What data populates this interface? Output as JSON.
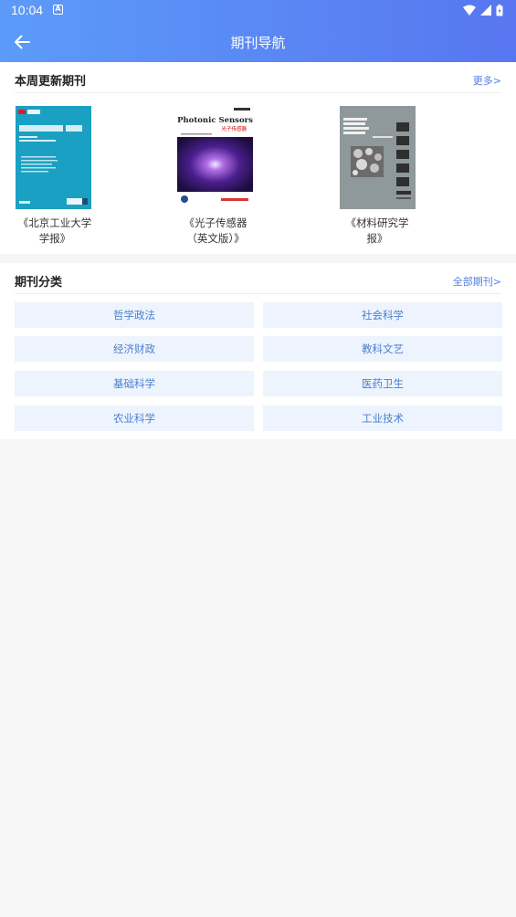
{
  "status_bar": {
    "time": "10:04",
    "a_icon_label": "A"
  },
  "nav": {
    "title": "期刊导航"
  },
  "weekly": {
    "title": "本周更新期刊",
    "more": "更多>",
    "journals": [
      {
        "name_line1": "《北京工业大学",
        "name_line2": "学报》",
        "cover_title": "北京工业大学 学报"
      },
      {
        "name_line1": "《光子传感器",
        "name_line2": "（英文版）》",
        "cover_title": "Photonic Sensors",
        "cover_subtitle": "光子传感器"
      },
      {
        "name_line1": "《材料研究学",
        "name_line2": "报》",
        "cover_title": "材料研究学报",
        "cover_subtitle": "CHINESE JOURNAL OF MATERIALS RESEARCH"
      }
    ]
  },
  "categories": {
    "title": "期刊分类",
    "more": "全部期刊>",
    "items": [
      "哲学政法",
      "社会科学",
      "经济财政",
      "教科文艺",
      "基础科学",
      "医药卫生",
      "农业科学",
      "工业技术"
    ]
  }
}
